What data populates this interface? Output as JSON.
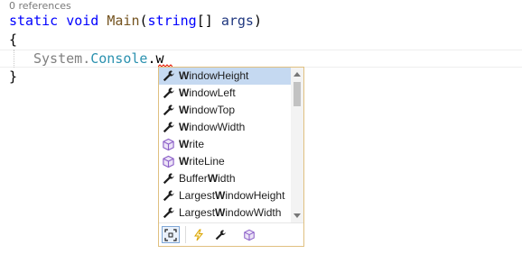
{
  "editor": {
    "codelens": "0 references",
    "line1": {
      "kw1": "static",
      "kw2": "void",
      "method": "Main",
      "open_paren": "(",
      "type": "string",
      "brackets": "[]",
      "param": "args",
      "close_paren": ")"
    },
    "line2": "{",
    "line3": {
      "ns": "System",
      "dot1": ".",
      "cls": "Console",
      "dot2": ".",
      "typed": "w"
    },
    "line4": "}"
  },
  "completion": {
    "selected_index": 0,
    "items": [
      {
        "kind": "wrench-icon",
        "prefix": "",
        "match": "W",
        "rest": "indowHeight"
      },
      {
        "kind": "wrench-icon",
        "prefix": "",
        "match": "W",
        "rest": "indowLeft"
      },
      {
        "kind": "wrench-icon",
        "prefix": "",
        "match": "W",
        "rest": "indowTop"
      },
      {
        "kind": "wrench-icon",
        "prefix": "",
        "match": "W",
        "rest": "indowWidth"
      },
      {
        "kind": "method-cube-icon",
        "prefix": "",
        "match": "W",
        "rest": "rite"
      },
      {
        "kind": "method-cube-icon",
        "prefix": "",
        "match": "W",
        "rest": "riteLine"
      },
      {
        "kind": "wrench-icon",
        "prefix": "Buffer",
        "match": "W",
        "rest": "idth"
      },
      {
        "kind": "wrench-icon",
        "prefix": "Largest",
        "match": "W",
        "rest": "indowHeight"
      },
      {
        "kind": "wrench-icon",
        "prefix": "Largest",
        "match": "W",
        "rest": "indowWidth"
      }
    ],
    "scroll_position": 0.0,
    "filters": [
      "expand-filter-icon",
      "lightning-event-icon",
      "wrench-property-icon",
      "cube-method-icon"
    ]
  },
  "colors": {
    "selection": "#c5d9f1",
    "popup_border": "#e0c080",
    "keyword": "#0000ff",
    "type": "#2b91af",
    "method": "#74531f",
    "param": "#1f377f",
    "method_icon": "#8c60c8",
    "event_icon": "#d9a300"
  }
}
